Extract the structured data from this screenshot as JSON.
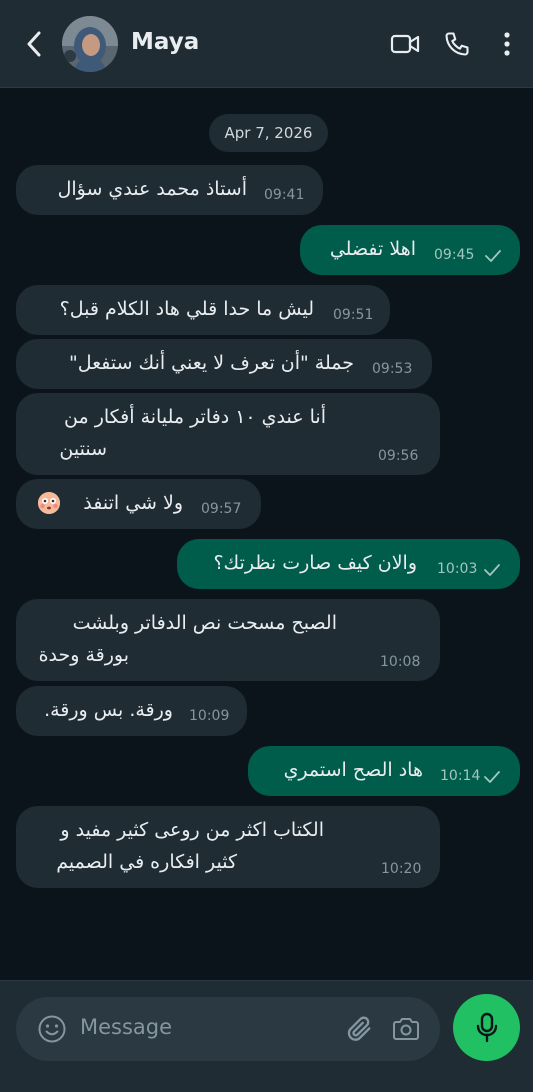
{
  "header": {
    "contact_name": "Maya",
    "icons": [
      "back-arrow-icon",
      "video-call-icon",
      "voice-call-icon",
      "more-vert-icon"
    ]
  },
  "date_separator": "Apr 7, 2026",
  "messages": [
    {
      "direction": "in",
      "lines": [
        "أستاذ محمد عندي سؤال"
      ],
      "time": "09:41"
    },
    {
      "direction": "out",
      "lines": [
        "اهلا تفضلي"
      ],
      "time": "09:45",
      "status": "sent-check"
    },
    {
      "direction": "in",
      "lines": [
        "ليش ما حدا قلي هاد الكلام قبل؟"
      ],
      "time": "09:51"
    },
    {
      "direction": "in",
      "lines": [
        "جملة \"أن تعرف لا يعني أنك ستفعل\""
      ],
      "time": "09:53"
    },
    {
      "direction": "in",
      "lines": [
        "أنا عندي ١٠ دفاتر مليانة أفكار من",
        "سنتين"
      ],
      "time": "09:56"
    },
    {
      "direction": "in",
      "lines": [
        "ولا شي اتنفذ"
      ],
      "time": "09:57",
      "emoji": "flushed-face-emoji"
    },
    {
      "direction": "out",
      "lines": [
        "والان كيف صارت نظرتك؟"
      ],
      "time": "10:03",
      "status": "sent-check"
    },
    {
      "direction": "in",
      "lines": [
        "الصبح مسحت نص الدفاتر وبلشت",
        "بورقة وحدة"
      ],
      "time": "10:08"
    },
    {
      "direction": "in",
      "lines": [
        "ورقة. بس ورقة."
      ],
      "time": "10:09"
    },
    {
      "direction": "out",
      "lines": [
        "هاد الصح استمري"
      ],
      "time": "10:14",
      "status": "sent-check"
    },
    {
      "direction": "in",
      "lines": [
        "الكتاب اكثر من روعى كثير مفيد و",
        "كثير افكاره في الصميم"
      ],
      "time": "10:20"
    }
  ],
  "composer": {
    "placeholder": "Message",
    "icons": [
      "emoji-icon",
      "attach-icon",
      "camera-icon",
      "mic-icon"
    ]
  },
  "colors": {
    "background": "#0b141a",
    "header": "#1f2c34",
    "incoming_bubble": "#1f2c34",
    "outgoing_bubble": "#005c4b",
    "accent": "#21c063"
  }
}
